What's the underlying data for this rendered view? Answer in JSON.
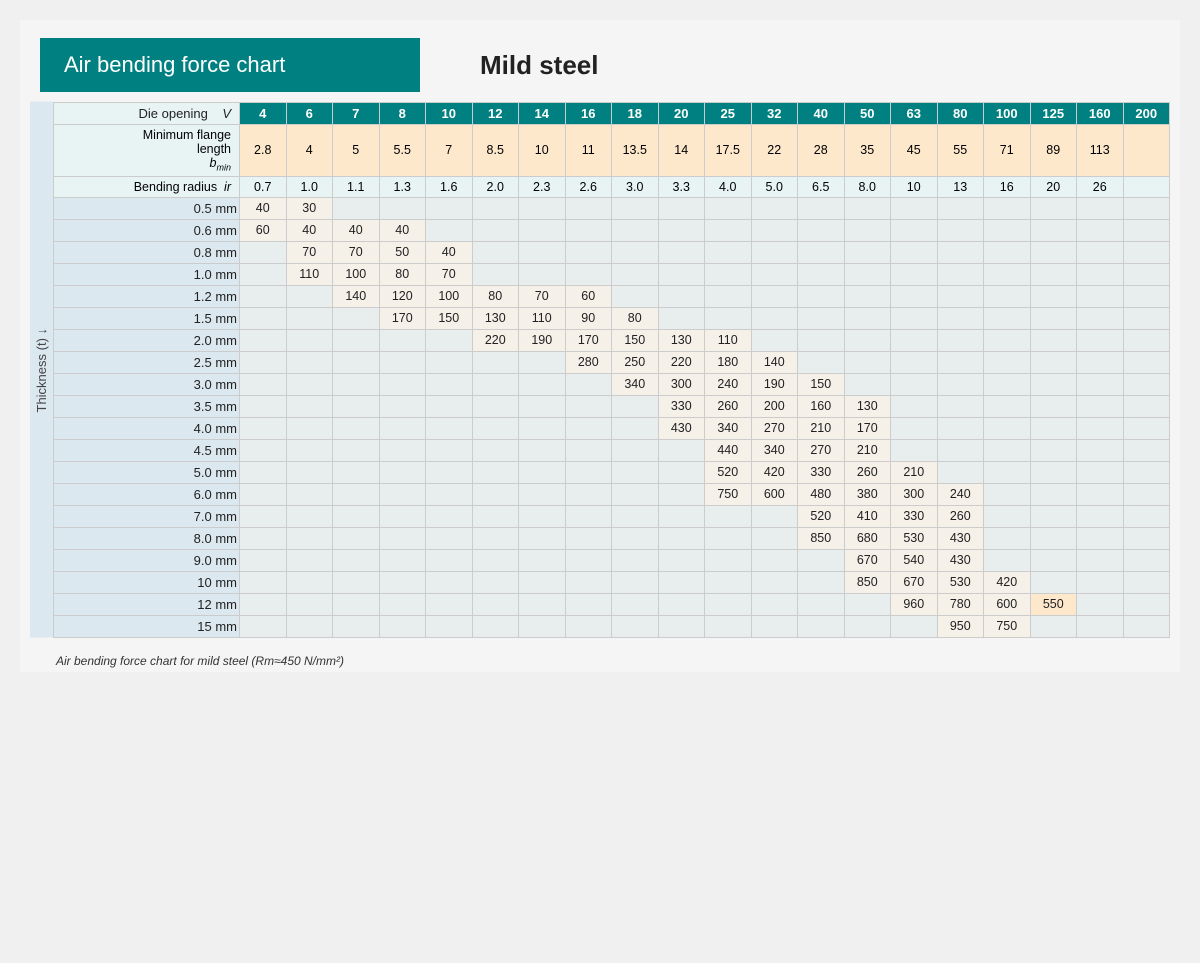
{
  "header": {
    "title": "Air bending force chart",
    "subtitle": "Mild steel"
  },
  "y_label": "Thickness (t) ↓",
  "footnote": "Air bending force chart for mild steel (Rm≈450 N/mm²)",
  "columns": {
    "die_openings": [
      "4",
      "6",
      "7",
      "8",
      "10",
      "12",
      "14",
      "16",
      "18",
      "20",
      "25",
      "32",
      "40",
      "50",
      "63",
      "80",
      "100",
      "125",
      "160",
      "200"
    ],
    "min_flange": [
      "2.8",
      "4",
      "5",
      "5.5",
      "7",
      "8.5",
      "10",
      "11",
      "13.5",
      "14",
      "17.5",
      "22",
      "28",
      "35",
      "45",
      "55",
      "71",
      "89",
      "113",
      ""
    ],
    "bend_radius": [
      "0.7",
      "1.0",
      "1.1",
      "1.3",
      "1.6",
      "2.0",
      "2.3",
      "2.6",
      "3.0",
      "3.3",
      "4.0",
      "5.0",
      "6.5",
      "8.0",
      "10",
      "13",
      "16",
      "20",
      "26",
      ""
    ]
  },
  "rows": [
    {
      "thickness": "0.5 mm",
      "values": [
        "40",
        "30",
        "",
        "",
        "",
        "",
        "",
        "",
        "",
        "",
        "",
        "",
        "",
        "",
        "",
        "",
        "",
        "",
        "",
        ""
      ]
    },
    {
      "thickness": "0.6 mm",
      "values": [
        "60",
        "40",
        "40",
        "40",
        "",
        "",
        "",
        "",
        "",
        "",
        "",
        "",
        "",
        "",
        "",
        "",
        "",
        "",
        "",
        ""
      ]
    },
    {
      "thickness": "0.8 mm",
      "values": [
        "",
        "70",
        "70",
        "50",
        "40",
        "",
        "",
        "",
        "",
        "",
        "",
        "",
        "",
        "",
        "",
        "",
        "",
        "",
        "",
        ""
      ]
    },
    {
      "thickness": "1.0 mm",
      "values": [
        "",
        "110",
        "100",
        "80",
        "70",
        "",
        "",
        "",
        "",
        "",
        "",
        "",
        "",
        "",
        "",
        "",
        "",
        "",
        "",
        ""
      ]
    },
    {
      "thickness": "1.2 mm",
      "values": [
        "",
        "",
        "140",
        "120",
        "100",
        "80",
        "70",
        "60",
        "",
        "",
        "",
        "",
        "",
        "",
        "",
        "",
        "",
        "",
        "",
        ""
      ]
    },
    {
      "thickness": "1.5 mm",
      "values": [
        "",
        "",
        "",
        "170",
        "150",
        "130",
        "110",
        "90",
        "80",
        "",
        "",
        "",
        "",
        "",
        "",
        "",
        "",
        "",
        "",
        ""
      ]
    },
    {
      "thickness": "2.0 mm",
      "values": [
        "",
        "",
        "",
        "",
        "",
        "220",
        "190",
        "170",
        "150",
        "130",
        "110",
        "",
        "",
        "",
        "",
        "",
        "",
        "",
        "",
        ""
      ]
    },
    {
      "thickness": "2.5 mm",
      "values": [
        "",
        "",
        "",
        "",
        "",
        "",
        "",
        "280",
        "250",
        "220",
        "180",
        "140",
        "",
        "",
        "",
        "",
        "",
        "",
        "",
        ""
      ]
    },
    {
      "thickness": "3.0 mm",
      "values": [
        "",
        "",
        "",
        "",
        "",
        "",
        "",
        "",
        "340",
        "300",
        "240",
        "190",
        "150",
        "",
        "",
        "",
        "",
        "",
        "",
        ""
      ]
    },
    {
      "thickness": "3.5 mm",
      "values": [
        "",
        "",
        "",
        "",
        "",
        "",
        "",
        "",
        "",
        "330",
        "260",
        "200",
        "160",
        "130",
        "",
        "",
        "",
        "",
        "",
        ""
      ]
    },
    {
      "thickness": "4.0 mm",
      "values": [
        "",
        "",
        "",
        "",
        "",
        "",
        "",
        "",
        "",
        "430",
        "340",
        "270",
        "210",
        "170",
        "",
        "",
        "",
        "",
        "",
        ""
      ]
    },
    {
      "thickness": "4.5 mm",
      "values": [
        "",
        "",
        "",
        "",
        "",
        "",
        "",
        "",
        "",
        "",
        "440",
        "340",
        "270",
        "210",
        "",
        "",
        "",
        "",
        "",
        ""
      ]
    },
    {
      "thickness": "5.0 mm",
      "values": [
        "",
        "",
        "",
        "",
        "",
        "",
        "",
        "",
        "",
        "",
        "520",
        "420",
        "330",
        "260",
        "210",
        "",
        "",
        "",
        "",
        ""
      ]
    },
    {
      "thickness": "6.0 mm",
      "values": [
        "",
        "",
        "",
        "",
        "",
        "",
        "",
        "",
        "",
        "",
        "750",
        "600",
        "480",
        "380",
        "300",
        "240",
        "",
        "",
        "",
        ""
      ]
    },
    {
      "thickness": "7.0 mm",
      "values": [
        "",
        "",
        "",
        "",
        "",
        "",
        "",
        "",
        "",
        "",
        "",
        "",
        "520",
        "410",
        "330",
        "260",
        "",
        "",
        "",
        ""
      ]
    },
    {
      "thickness": "8.0 mm",
      "values": [
        "",
        "",
        "",
        "",
        "",
        "",
        "",
        "",
        "",
        "",
        "",
        "",
        "850",
        "680",
        "530",
        "430",
        "",
        "",
        "",
        ""
      ]
    },
    {
      "thickness": "9.0 mm",
      "values": [
        "",
        "",
        "",
        "",
        "",
        "",
        "",
        "",
        "",
        "",
        "",
        "",
        "",
        "670",
        "540",
        "430",
        "",
        "",
        "",
        ""
      ]
    },
    {
      "thickness": "10 mm",
      "values": [
        "",
        "",
        "",
        "",
        "",
        "",
        "",
        "",
        "",
        "",
        "",
        "",
        "",
        "850",
        "670",
        "530",
        "420",
        "",
        "",
        ""
      ]
    },
    {
      "thickness": "12 mm",
      "values": [
        "",
        "",
        "",
        "",
        "",
        "",
        "",
        "",
        "",
        "",
        "",
        "",
        "",
        "",
        "960",
        "780",
        "600",
        "550",
        "",
        ""
      ]
    },
    {
      "thickness": "15 mm",
      "values": [
        "",
        "",
        "",
        "",
        "",
        "",
        "",
        "",
        "",
        "",
        "",
        "",
        "",
        "",
        "",
        "950",
        "750",
        "",
        "",
        ""
      ]
    }
  ]
}
